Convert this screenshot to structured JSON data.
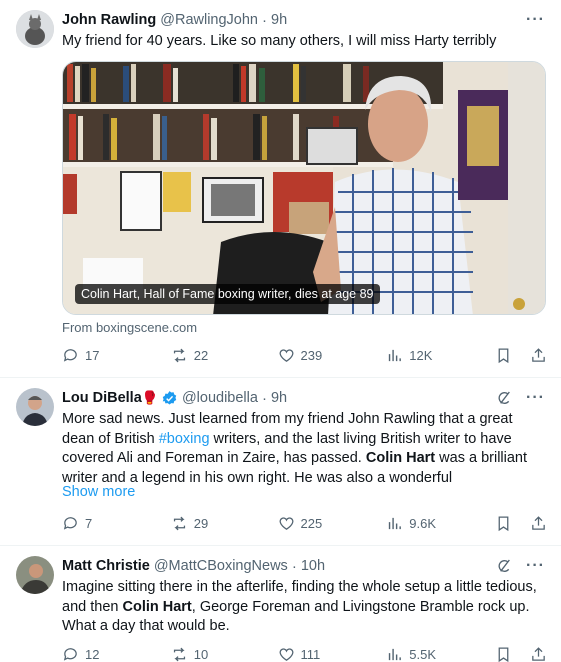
{
  "tweets": [
    {
      "name": "John Rawling",
      "handle": "@RawlingJohn",
      "time": "9h",
      "text": "My friend for 40 years. Like so many others, I will miss Harty terribly",
      "card": {
        "caption": "Colin Hart, Hall of Fame boxing writer, dies at age 89",
        "source": "From boxingscene.com"
      },
      "stats": {
        "replies": "17",
        "reposts": "22",
        "likes": "239",
        "views": "12K"
      }
    },
    {
      "name": "Lou DiBella",
      "name_emoji": "🥊",
      "verified": true,
      "handle": "@loudibella",
      "time": "9h",
      "text": {
        "p1": "More sad news. Just learned from my friend John Rawling that a great dean of British ",
        "hashtag": "#boxing",
        "p2": " writers, and the last living British writer to have covered Ali and Foreman in Zaire, has passed. ",
        "bold": "Colin Hart",
        "p3": " was a brilliant writer and a legend in his own right. He was also a wonderful"
      },
      "show_more": "Show more",
      "stats": {
        "replies": "7",
        "reposts": "29",
        "likes": "225",
        "views": "9.6K"
      }
    },
    {
      "name": "Matt Christie",
      "handle": "@MattCBoxingNews",
      "time": "10h",
      "text": {
        "p1": "Imagine sitting there in the afterlife, finding the whole setup a little tedious, and then ",
        "bold": "Colin Hart",
        "p2": ", George Foreman and Livingstone Bramble rock up. What a day that would be."
      },
      "stats": {
        "replies": "12",
        "reposts": "10",
        "likes": "111",
        "views": "5.5K"
      }
    }
  ],
  "colors": {
    "link": "#1d9bf0",
    "muted": "#536471",
    "verified": "#1d9bf0"
  },
  "icons": [
    "reply-icon",
    "repost-icon",
    "like-icon",
    "views-icon",
    "bookmark-icon",
    "share-icon",
    "more-icon",
    "grok-icon",
    "verified-badge-icon"
  ]
}
